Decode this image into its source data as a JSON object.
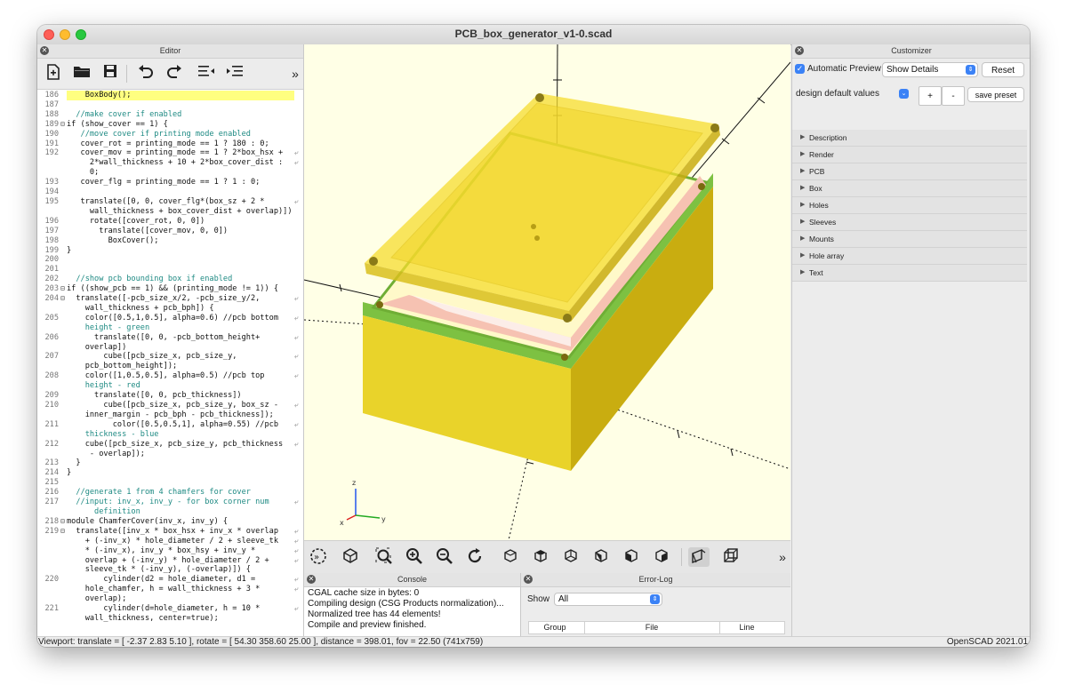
{
  "window": {
    "title": "PCB_box_generator_v1-0.scad"
  },
  "editor": {
    "header": "Editor",
    "toolbar": [
      "new-file-icon",
      "open-folder-icon",
      "save-icon",
      "undo-icon",
      "redo-icon",
      "unindent-icon",
      "indent-icon",
      "more-icon"
    ],
    "lines": [
      {
        "n": "186",
        "f": "",
        "t": "    BoxBody();",
        "w": false,
        "hl": true
      },
      {
        "n": "187",
        "f": "",
        "t": "",
        "w": false
      },
      {
        "n": "188",
        "f": "",
        "t": "  //make cover if enabled",
        "w": false,
        "c": true
      },
      {
        "n": "189",
        "f": "⊟",
        "t": "if (show_cover == 1) {",
        "w": false
      },
      {
        "n": "190",
        "f": "",
        "t": "   //move cover if printing mode enabled",
        "w": false,
        "c": true
      },
      {
        "n": "191",
        "f": "",
        "t": "   cover_rot = printing_mode == 1 ? 180 : 0;",
        "w": false
      },
      {
        "n": "192",
        "f": "",
        "t": "   cover_mov = printing_mode == 1 ? 2*box_hsx +",
        "w": true
      },
      {
        "n": "",
        "f": "",
        "t": "     2*wall_thickness + 10 + 2*box_cover_dist :",
        "w": true
      },
      {
        "n": "",
        "f": "",
        "t": "     0;",
        "w": false
      },
      {
        "n": "193",
        "f": "",
        "t": "   cover_flg = printing_mode == 1 ? 1 : 0;",
        "w": false
      },
      {
        "n": "194",
        "f": "",
        "t": "",
        "w": false
      },
      {
        "n": "195",
        "f": "",
        "t": "   translate([0, 0, cover_flg*(box_sz + 2 *",
        "w": true
      },
      {
        "n": "",
        "f": "",
        "t": "     wall_thickness + box_cover_dist + overlap)])",
        "w": false
      },
      {
        "n": "196",
        "f": "",
        "t": "     rotate([cover_rot, 0, 0])",
        "w": false
      },
      {
        "n": "197",
        "f": "",
        "t": "       translate([cover_mov, 0, 0])",
        "w": false
      },
      {
        "n": "198",
        "f": "",
        "t": "         BoxCover();",
        "w": false
      },
      {
        "n": "199",
        "f": "",
        "t": "}",
        "w": false
      },
      {
        "n": "200",
        "f": "",
        "t": "",
        "w": false
      },
      {
        "n": "201",
        "f": "",
        "t": "",
        "w": false
      },
      {
        "n": "202",
        "f": "",
        "t": "  //show pcb bounding box if enabled",
        "w": false,
        "c": true
      },
      {
        "n": "203",
        "f": "⊟",
        "t": "if ((show_pcb == 1) && (printing_mode != 1)) {",
        "w": false
      },
      {
        "n": "204",
        "f": "⊟",
        "t": "  translate([-pcb_size_x/2, -pcb_size_y/2,",
        "w": true
      },
      {
        "n": "",
        "f": "",
        "t": "    wall_thickness + pcb_bph]) {",
        "w": false
      },
      {
        "n": "205",
        "f": "",
        "t": "    color([0.5,1,0.5], alpha=0.6) //pcb bottom",
        "w": true
      },
      {
        "n": "",
        "f": "",
        "t": "    height - green",
        "w": false,
        "c": true
      },
      {
        "n": "206",
        "f": "",
        "t": "      translate([0, 0, -pcb_bottom_height+",
        "w": true
      },
      {
        "n": "",
        "f": "",
        "t": "    overlap])",
        "w": false
      },
      {
        "n": "207",
        "f": "",
        "t": "        cube([pcb_size_x, pcb_size_y,",
        "w": true
      },
      {
        "n": "",
        "f": "",
        "t": "    pcb_bottom_height]);",
        "w": false
      },
      {
        "n": "208",
        "f": "",
        "t": "    color([1,0.5,0.5], alpha=0.5) //pcb top",
        "w": true
      },
      {
        "n": "",
        "f": "",
        "t": "    height - red",
        "w": false,
        "c": true
      },
      {
        "n": "209",
        "f": "",
        "t": "      translate([0, 0, pcb_thickness])",
        "w": false
      },
      {
        "n": "210",
        "f": "",
        "t": "        cube([pcb_size_x, pcb_size_y, box_sz -",
        "w": true
      },
      {
        "n": "",
        "f": "",
        "t": "    inner_margin - pcb_bph - pcb_thickness]);",
        "w": false
      },
      {
        "n": "211",
        "f": "",
        "t": "          color([0.5,0.5,1], alpha=0.55) //pcb",
        "w": true
      },
      {
        "n": "",
        "f": "",
        "t": "    thickness - blue",
        "w": false,
        "c": true
      },
      {
        "n": "212",
        "f": "",
        "t": "    cube([pcb_size_x, pcb_size_y, pcb_thickness",
        "w": true
      },
      {
        "n": "",
        "f": "",
        "t": "     - overlap]);",
        "w": false
      },
      {
        "n": "213",
        "f": "",
        "t": "  }",
        "w": false
      },
      {
        "n": "214",
        "f": "",
        "t": "}",
        "w": false
      },
      {
        "n": "215",
        "f": "",
        "t": "",
        "w": false
      },
      {
        "n": "216",
        "f": "",
        "t": "  //generate 1 from 4 chamfers for cover",
        "w": false,
        "c": true
      },
      {
        "n": "217",
        "f": "",
        "t": "  //input: inv_x, inv_y - for box corner num",
        "w": true,
        "c": true
      },
      {
        "n": "",
        "f": "",
        "t": "      definition",
        "w": false,
        "c": true
      },
      {
        "n": "218",
        "f": "⊟",
        "t": "module ChamferCover(inv_x, inv_y) {",
        "w": false
      },
      {
        "n": "219",
        "f": "⊟",
        "t": "  translate([inv_x * box_hsx + inv_x * overlap",
        "w": true
      },
      {
        "n": "",
        "f": "",
        "t": "    + (-inv_x) * hole_diameter / 2 + sleeve_tk",
        "w": true
      },
      {
        "n": "",
        "f": "",
        "t": "    * (-inv_x), inv_y * box_hsy + inv_y *",
        "w": true
      },
      {
        "n": "",
        "f": "",
        "t": "    overlap + (-inv_y) * hole_diameter / 2 +",
        "w": true
      },
      {
        "n": "",
        "f": "",
        "t": "    sleeve_tk * (-inv_y), (-overlap)]) {",
        "w": false
      },
      {
        "n": "220",
        "f": "",
        "t": "        cylinder(d2 = hole_diameter, d1 =",
        "w": true
      },
      {
        "n": "",
        "f": "",
        "t": "    hole_chamfer, h = wall_thickness + 3 *",
        "w": true
      },
      {
        "n": "",
        "f": "",
        "t": "    overlap);",
        "w": false
      },
      {
        "n": "221",
        "f": "",
        "t": "        cylinder(d=hole_diameter, h = 10 *",
        "w": true
      },
      {
        "n": "",
        "f": "",
        "t": "    wall_thickness, center=true);",
        "w": false
      }
    ]
  },
  "viewport": {
    "axes": {
      "x": "x",
      "y": "y",
      "z": "z"
    },
    "toolbar": [
      "animate-icon",
      "preview-icon",
      "view-all-icon",
      "zoom-in-icon",
      "zoom-out-icon",
      "reset-view-icon",
      "view-right-icon",
      "view-top-icon",
      "view-bottom-icon",
      "view-left-icon",
      "view-front-icon",
      "view-back-icon",
      "perspective-icon",
      "orthogonal-icon",
      "more-icon"
    ]
  },
  "console": {
    "header": "Console",
    "lines": [
      "CGAL cache size in bytes: 0",
      "Compiling design (CSG Products normalization)...",
      "Normalized tree has 44 elements!",
      "Compile and preview finished."
    ]
  },
  "errorlog": {
    "header": "Error-Log",
    "show_label": "Show",
    "show_value": "All",
    "columns": [
      "Group",
      "File",
      "Line"
    ]
  },
  "customizer": {
    "header": "Customizer",
    "auto_preview_label": "Automatic Preview",
    "auto_preview_checked": true,
    "details_value": "Show Details",
    "reset_label": "Reset",
    "preset_value": "design default values",
    "plus_label": "+",
    "minus_label": "-",
    "save_preset_label": "save preset",
    "sections": [
      "Description",
      "Render",
      "PCB",
      "Box",
      "Holes",
      "Sleeves",
      "Mounts",
      "Hole array",
      "Text"
    ]
  },
  "statusbar": {
    "viewport": "Viewport: translate = [ -2.37 2.83 5.10 ], rotate = [ 54.30 358.60 25.00 ], distance = 398.01, fov = 22.50 (741x759)",
    "version": "OpenSCAD 2021.01"
  },
  "colors": {
    "accent": "#3b82f6",
    "model_yellow": "#f5dc2f",
    "model_green": "#7dc142",
    "viewport_bg": "#ffffe6"
  }
}
